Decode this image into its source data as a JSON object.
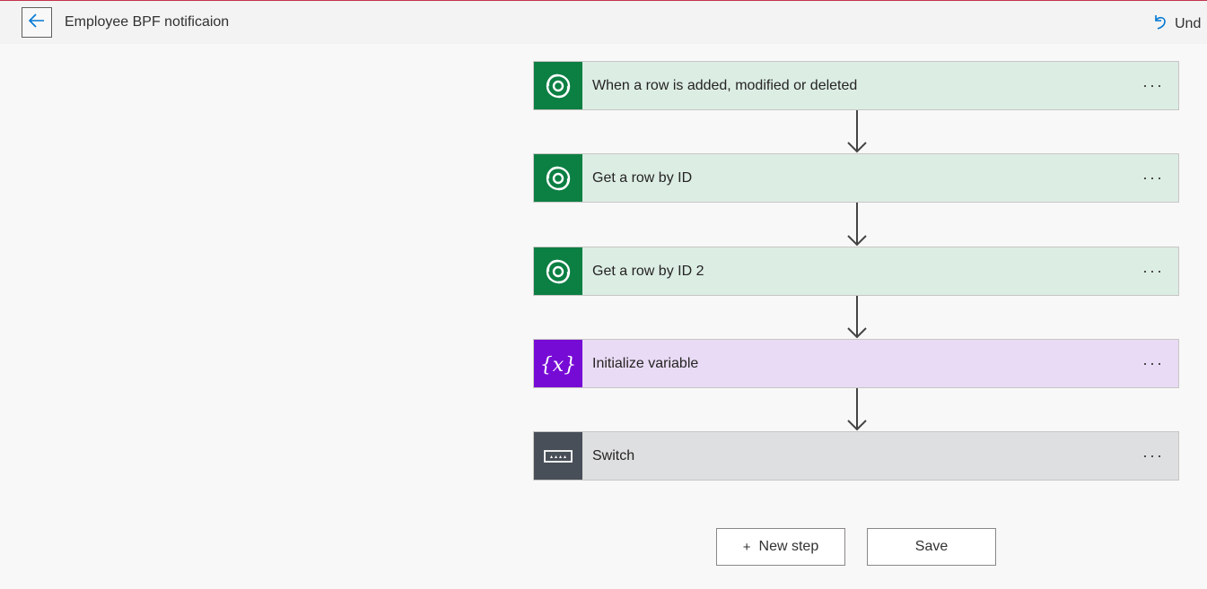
{
  "header": {
    "title": "Employee BPF notificaion",
    "undo_label": "Und",
    "back_icon": "arrow-left-icon",
    "undo_icon": "undo-icon"
  },
  "steps": [
    {
      "title": "When a row is added, modified or deleted",
      "type": "dataverse",
      "icon": "dataverse-icon",
      "more": "···"
    },
    {
      "title": "Get a row by ID",
      "type": "dataverse",
      "icon": "dataverse-icon",
      "more": "···"
    },
    {
      "title": "Get a row by ID 2",
      "type": "dataverse",
      "icon": "dataverse-icon",
      "more": "···"
    },
    {
      "title": "Initialize variable",
      "type": "variable",
      "icon": "variable-icon",
      "more": "···"
    },
    {
      "title": "Switch",
      "type": "switch",
      "icon": "switch-icon",
      "more": "···"
    }
  ],
  "actions": {
    "new_step_plus": "+",
    "new_step_label": "New step",
    "save_label": "Save"
  },
  "colors": {
    "dataverse_icon_bg": "#0c7f43",
    "dataverse_card_bg": "#dcede4",
    "variable_icon_bg": "#770bd6",
    "variable_card_bg": "#e9dbf5",
    "switch_icon_bg": "#484f58",
    "switch_card_bg": "#dedfe0",
    "accent_blue": "#0078d4"
  }
}
